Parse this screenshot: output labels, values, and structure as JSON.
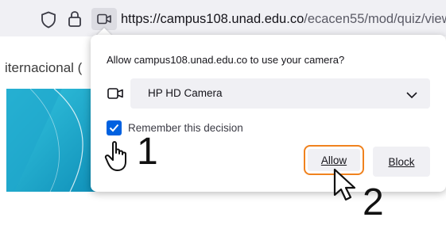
{
  "urlbar": {
    "url_host": "https://campus108.unad.edu.co",
    "url_path": "/ecacen55/mod/quiz/view",
    "shield_icon": "shield-icon",
    "lock_icon": "lock-icon",
    "camera_permission_icon": "camera-icon"
  },
  "page": {
    "partial_text": "iternacional ("
  },
  "popup": {
    "title": "Allow campus108.unad.edu.co to use your camera?",
    "device_select_value": "HP HD Camera",
    "remember_checked": true,
    "remember_label": "Remember this decision",
    "allow_label": "Allow",
    "block_label": "Block"
  },
  "annotations": {
    "step1": "1",
    "step2": "2"
  },
  "colors": {
    "accent": "#0061e0",
    "highlight": "#f0821e",
    "banner_teal": "#17b4d4"
  }
}
